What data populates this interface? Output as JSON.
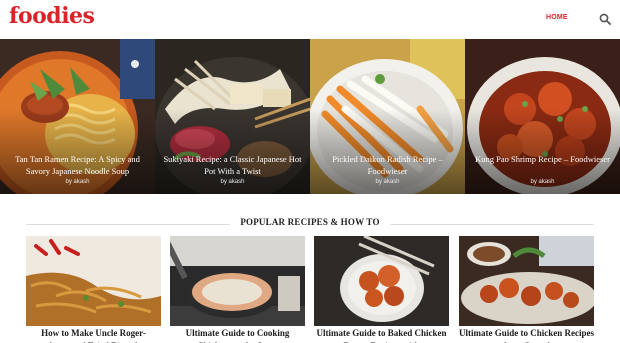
{
  "header": {
    "logo": "foodies",
    "nav_home": "HOME",
    "search_icon": "search-icon",
    "accent": "#d9252a"
  },
  "hero": [
    {
      "title": "Tan Tan Ramen Recipe: A Spicy and Savory Japanese Noodle Soup",
      "author": "by akash"
    },
    {
      "title": "Sukiyaki Recipe: a Classic Japanese Hot Pot With a Twist",
      "author": "by akash"
    },
    {
      "title": "Pickled Daikon Radish Recipe – Foodwieser",
      "author": "by akash"
    },
    {
      "title": "Kung Pao Shrimp Recipe – Foodwieser",
      "author": "by akash"
    }
  ],
  "popular": {
    "heading": "POPULAR RECIPES & HOW TO",
    "items": [
      {
        "title": "How to Make Uncle Roger-Approved Fried Rice: A"
      },
      {
        "title": "Ultimate Guide to Cooking Chicken on the Stove"
      },
      {
        "title": "Ultimate Guide to Baked Chicken Breast Recipes with"
      },
      {
        "title": "Ultimate Guide to Chicken Recipes for a Crowd"
      }
    ]
  }
}
